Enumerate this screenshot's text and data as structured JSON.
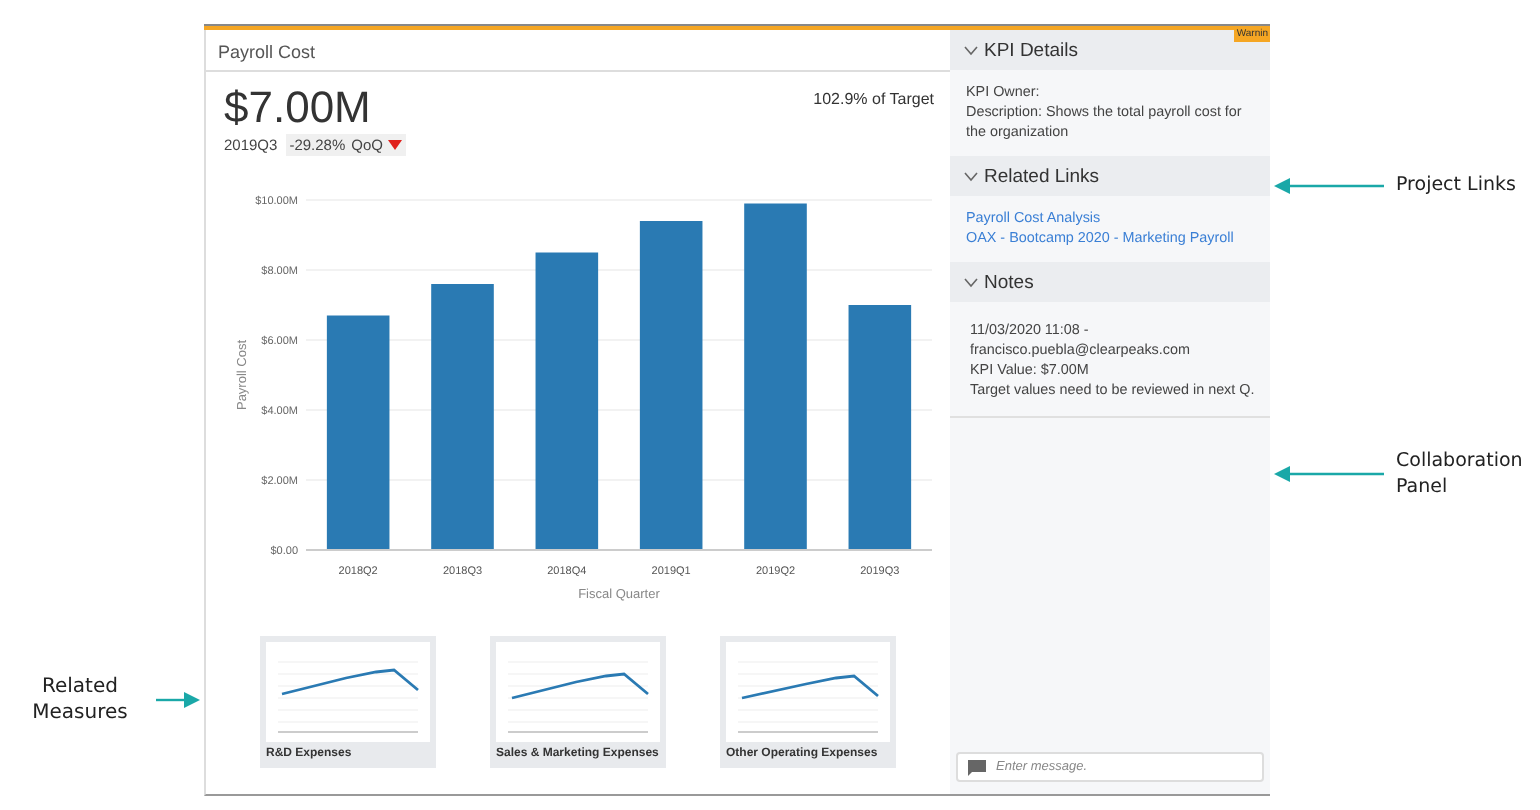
{
  "kpi_card": {
    "title": "Payroll Cost",
    "value": "$7.00M",
    "period": "2019Q3",
    "change": "-29.28%",
    "comparison": "QoQ",
    "trend_down": true,
    "target": "102.9% of Target",
    "chart_data": {
      "type": "bar",
      "xlabel": "Fiscal Quarter",
      "ylabel": "Payroll Cost",
      "categories": [
        "2018Q2",
        "2018Q3",
        "2018Q4",
        "2019Q1",
        "2019Q2",
        "2019Q3"
      ],
      "grid": true,
      "series": [
        {
          "color": "#2a7ab3",
          "values": [
            6.7,
            7.6,
            8.5,
            9.4,
            9.9,
            7.0
          ]
        }
      ],
      "ylim": [
        0,
        10
      ],
      "yticks": [
        {
          "value": 0,
          "label": "$0.00"
        },
        {
          "value": 2,
          "label": "$2.00M"
        },
        {
          "value": 4,
          "label": "$4.00M"
        },
        {
          "value": 6,
          "label": "$6.00M"
        },
        {
          "value": 8,
          "label": "$8.00M"
        },
        {
          "value": 10,
          "label": "$10.00M"
        }
      ]
    },
    "related_measures": [
      {
        "label": "R&D Expenses"
      },
      {
        "label": "Sales & Marketing Expenses"
      },
      {
        "label": "Other Operating Expenses"
      }
    ]
  },
  "side_panel": {
    "badge": "Warnin",
    "sections": [
      {
        "title": "KPI Details",
        "expanded": true,
        "kind": "text",
        "lines": [
          "KPI Owner:",
          "Description: Shows the total payroll cost for the organization"
        ]
      },
      {
        "title": "Related Links",
        "expanded": true,
        "kind": "links",
        "lines": [
          "Payroll Cost Analysis",
          "OAX - Bootcamp 2020 - Marketing Payroll"
        ]
      },
      {
        "title": "Notes",
        "expanded": true,
        "kind": "text",
        "lines": [
          "11/03/2020 11:08 -",
          "francisco.puebla@clearpeaks.com",
          "KPI Value: $7.00M",
          "Target values need to be reviewed in next Q."
        ]
      }
    ],
    "message": {
      "placeholder": "Enter message."
    }
  },
  "callouts": {
    "left": [
      {
        "text": "Related Measures"
      }
    ],
    "right": [
      {
        "text": "Project Links"
      },
      {
        "text": "Collaboration Panel"
      }
    ]
  }
}
